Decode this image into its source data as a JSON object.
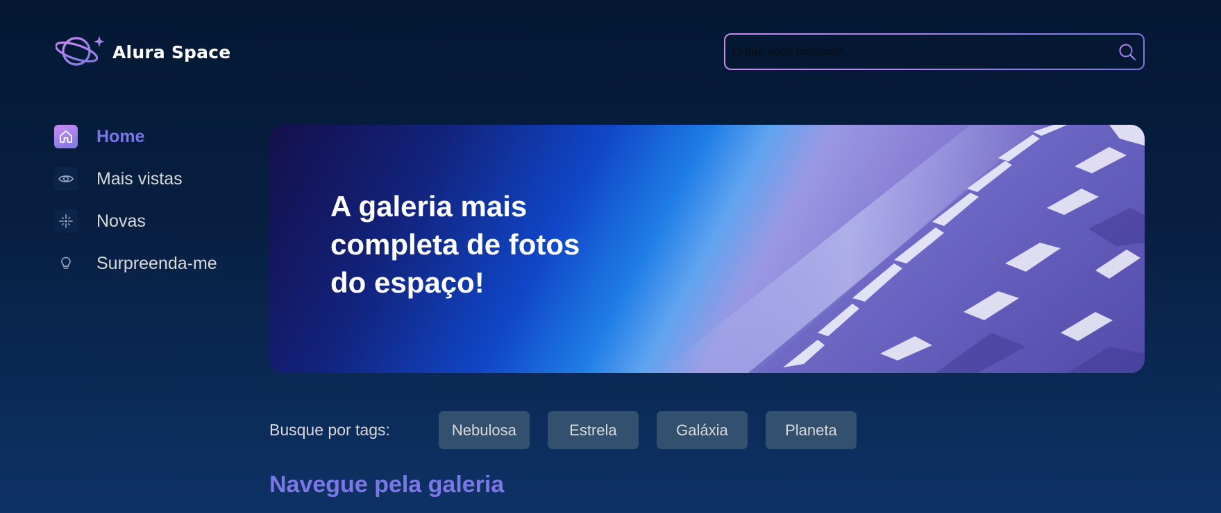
{
  "header": {
    "logo_text": "Alura Space",
    "search": {
      "placeholder": "O que você procura?",
      "icon": "search-icon"
    }
  },
  "sidebar": {
    "items": [
      {
        "label": "Home",
        "icon": "home-icon",
        "active": true
      },
      {
        "label": "Mais vistas",
        "icon": "eye-icon",
        "active": false
      },
      {
        "label": "Novas",
        "icon": "sparkle-icon",
        "active": false
      },
      {
        "label": "Surpreenda-me",
        "icon": "lightbulb-icon",
        "active": false
      }
    ]
  },
  "banner": {
    "title": "A galeria mais completa de fotos do espaço!"
  },
  "tags": {
    "label": "Busque por tags:",
    "items": [
      "Nebulosa",
      "Estrela",
      "Galáxia",
      "Planeta"
    ]
  },
  "gallery": {
    "title": "Navegue pela galeria"
  },
  "colors": {
    "accent": "#7b78e5",
    "accent_light": "#c98cf1",
    "background_top": "#041833",
    "background_bottom": "#0e3266",
    "tag_background": "#34506f"
  }
}
